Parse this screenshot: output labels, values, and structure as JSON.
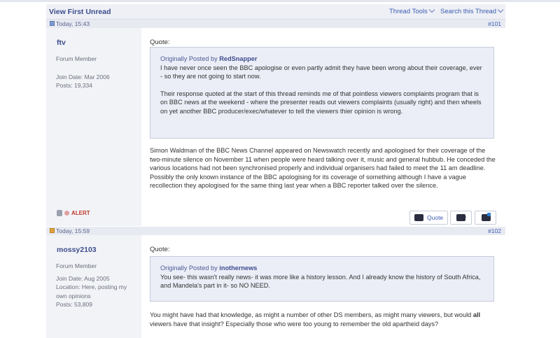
{
  "toolbar": {
    "view_first_unread": "View First Unread",
    "thread_tools": "Thread Tools",
    "search_thread": "Search this Thread"
  },
  "posts": [
    {
      "date": "Today, 15:43",
      "number": "#101",
      "user": {
        "name": "ftv",
        "title": "Forum Member",
        "join": "Join Date: Mar 2006",
        "posts": "Posts: 19,334"
      },
      "quote_label": "Quote:",
      "quote": {
        "by_prefix": "Originally Posted by",
        "by_user": "RedSnapper",
        "para1": "I have never once seen the BBC apologise or even partly admit they have been wrong about their coverage, ever - so they are not going to start now.",
        "para2": "Their response quoted at the start of this thread reminds me of that pointless viewers complaints program that is on BBC news at the weekend - where the presenter reads out viewers complaints (usually right) and then wheels on yet another BBC producer/exec/whatever to tell the viewers thier opinion is wrong."
      },
      "message": "Simon Waldman of the BBC News Channel appeared on Newswatch recently and apologised for their coverage of the two-minute silence on November 11 when people were heard talking over it, music and general hubbub. He conceded the various locations had not been synchronised properly and individual organisers had failed to meet the 11 am deadline. Possibly the only known instance of the BBC apologising for its coverage of something although I have a vague recollection they apologised for the same thing last year when a BBC reporter talked over the silence.",
      "alert": "ALERT",
      "quote_button": "Quote"
    },
    {
      "date": "Today, 15:59",
      "number": "#102",
      "user": {
        "name": "mossy2103",
        "title": "Forum Member",
        "join": "Join Date: Aug 2005",
        "location": "Location: Here, posting my own opinions",
        "posts": "Posts: 53,809"
      },
      "quote_label": "Quote:",
      "quote": {
        "by_prefix": "Originally Posted by",
        "by_user": "inothernews",
        "para1": "You see- this wasn't really news- it was more like a history lesson. And I already know the history of South Africa, and Mandela's part in it- so NO NEED."
      },
      "message_pre": "You might have had that knowledge, as might a number of other DS members, as might many viewers, but would ",
      "message_bold": "all",
      "message_post": " viewers have that insight? Especially those who were too young to remember the old apartheid days?"
    }
  ]
}
